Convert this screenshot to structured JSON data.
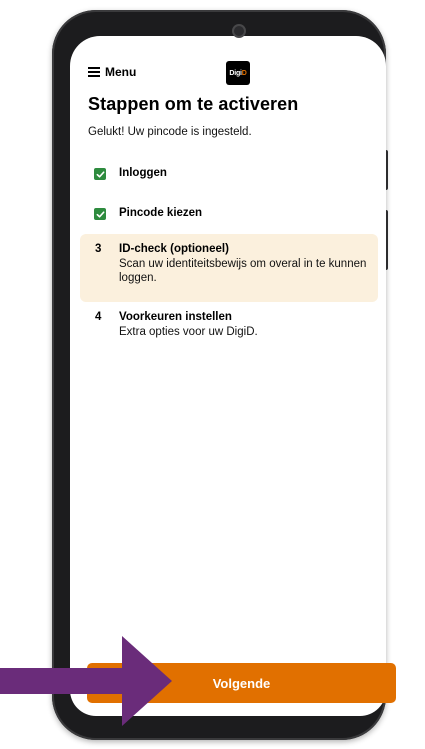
{
  "header": {
    "menu_label": "Menu",
    "logo_text_a": "Digi",
    "logo_text_b": "D"
  },
  "page": {
    "title": "Stappen om te activeren",
    "subtitle": "Gelukt! Uw pincode is ingesteld."
  },
  "steps": [
    {
      "status": "done",
      "title": "Inloggen"
    },
    {
      "status": "done",
      "title": "Pincode kiezen"
    },
    {
      "status": "active",
      "number": "3",
      "title": "ID-check (optioneel)",
      "description": "Scan uw identiteitsbewijs om overal in te kunnen loggen."
    },
    {
      "status": "todo",
      "number": "4",
      "title": "Voorkeuren instellen",
      "description": "Extra opties voor uw DigiD."
    }
  ],
  "footer": {
    "next_label": "Volgende"
  },
  "colors": {
    "accent": "#e17000",
    "check": "#2e8b3e",
    "active_background": "#fbf0dd",
    "arrow": "#6a2c7a"
  },
  "icons": [
    "menu-icon",
    "digid-logo",
    "checkmark-icon",
    "pointer-arrow"
  ]
}
